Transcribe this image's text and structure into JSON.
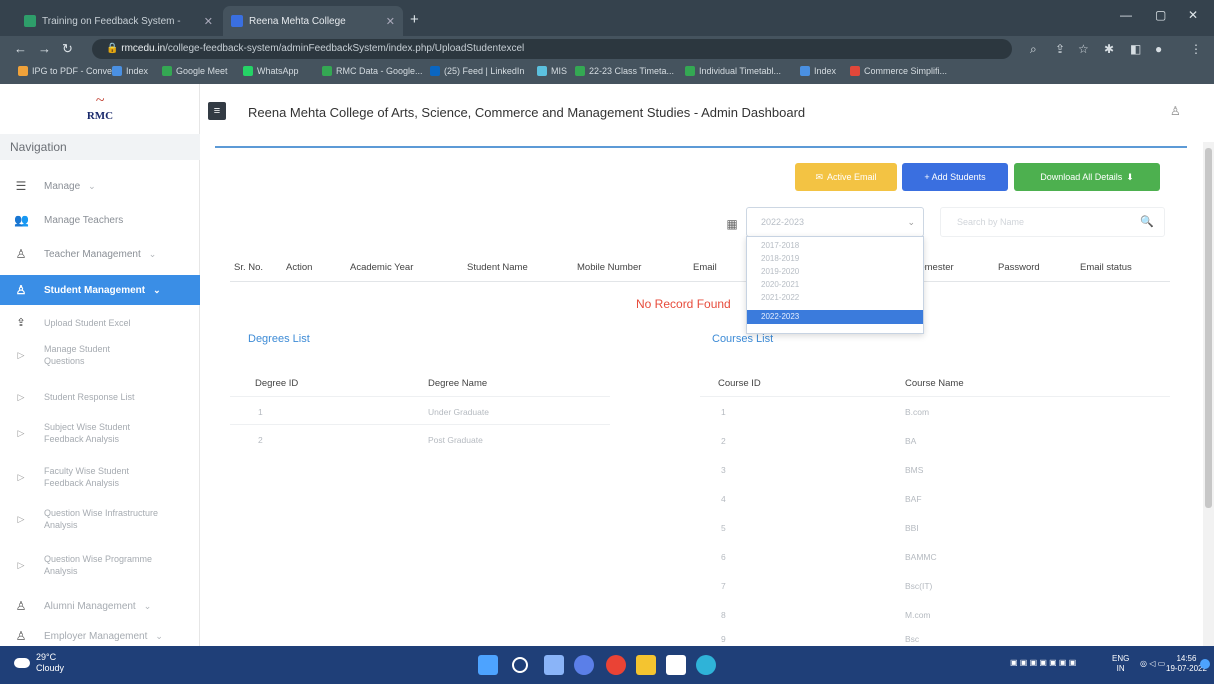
{
  "browser": {
    "tabs": [
      {
        "title": "Training on Feedback System - ",
        "active": false
      },
      {
        "title": "Reena Mehta College",
        "active": true
      }
    ],
    "url_host": "rmcedu.in",
    "url_path": "/college-feedback-system/adminFeedbackSystem/index.php/UploadStudentexcel",
    "bookmarks": [
      "IPG to PDF - Conve...",
      "Index",
      "Google Meet",
      "WhatsApp",
      "RMC Data - Google...",
      "(25) Feed | LinkedIn",
      "MIS",
      "22-23 Class Timeta...",
      "Individual Timetabl...",
      "Index",
      "Commerce Simplifi..."
    ]
  },
  "app": {
    "logo_text": "RMC",
    "title": "Reena Mehta College of Arts, Science, Commerce and Management Studies - Admin Dashboard"
  },
  "sidebar": {
    "heading": "Navigation",
    "items": [
      {
        "label": "Manage",
        "icon": "list-icon",
        "chevron": true
      },
      {
        "label": "Manage Teachers",
        "icon": "users-icon",
        "chevron": false
      },
      {
        "label": "Teacher Management",
        "icon": "user-icon",
        "chevron": true
      },
      {
        "label": "Student Management",
        "icon": "user-icon",
        "chevron": true,
        "active": true
      },
      {
        "label": "Upload Student Excel",
        "icon": "upload-icon",
        "chevron": false
      },
      {
        "label": "Manage Student Questions",
        "icon": "play-icon",
        "chevron": false
      },
      {
        "label": "Student Response List",
        "icon": "play-icon",
        "chevron": false
      },
      {
        "label": "Subject Wise Student Feedback Analysis",
        "icon": "play-icon",
        "chevron": false
      },
      {
        "label": "Faculty Wise Student Feedback Analysis",
        "icon": "play-icon",
        "chevron": false
      },
      {
        "label": "Question Wise Infrastructure Analysis",
        "icon": "play-icon",
        "chevron": false
      },
      {
        "label": "Question Wise Programme Analysis",
        "icon": "play-icon",
        "chevron": false
      },
      {
        "label": "Alumni Management",
        "icon": "user-icon",
        "chevron": true
      },
      {
        "label": "Employer Management",
        "icon": "user-icon",
        "chevron": true
      }
    ]
  },
  "toolbar": {
    "send_email_label": "Active Email",
    "add_students_label": "+ Add Students",
    "download_label": "Download All Details"
  },
  "filters": {
    "year_selected": "2022-2023",
    "search_placeholder": "Search by Name",
    "year_options": [
      "2017-2018",
      "2018-2019",
      "2019-2020",
      "2020-2021",
      "2021-2022",
      "2022-2023"
    ]
  },
  "students_table": {
    "columns": [
      "Sr. No.",
      "Action",
      "Academic Year",
      "Student Name",
      "Mobile Number",
      "Email",
      "Semester",
      "Password",
      "Email status"
    ],
    "empty_message": "No Record Found"
  },
  "degrees": {
    "title": "Degrees List",
    "columns": [
      "Degree ID",
      "Degree Name"
    ],
    "rows": [
      [
        "1",
        "Under Graduate"
      ],
      [
        "2",
        "Post Graduate"
      ]
    ]
  },
  "courses": {
    "title": "Courses List",
    "columns": [
      "Course ID",
      "Course Name"
    ],
    "rows": [
      [
        "1",
        "B.com"
      ],
      [
        "2",
        "BA"
      ],
      [
        "3",
        "BMS"
      ],
      [
        "4",
        "BAF"
      ],
      [
        "5",
        "BBI"
      ],
      [
        "6",
        "BAMMC"
      ],
      [
        "7",
        "Bsc(IT)"
      ],
      [
        "8",
        "M.com"
      ],
      [
        "9",
        "Bsc"
      ]
    ]
  },
  "taskbar": {
    "temperature": "29°C",
    "weather": "Cloudy",
    "lang": "ENG",
    "region": "IN",
    "time": "14:56",
    "date": "19-07-2022"
  }
}
